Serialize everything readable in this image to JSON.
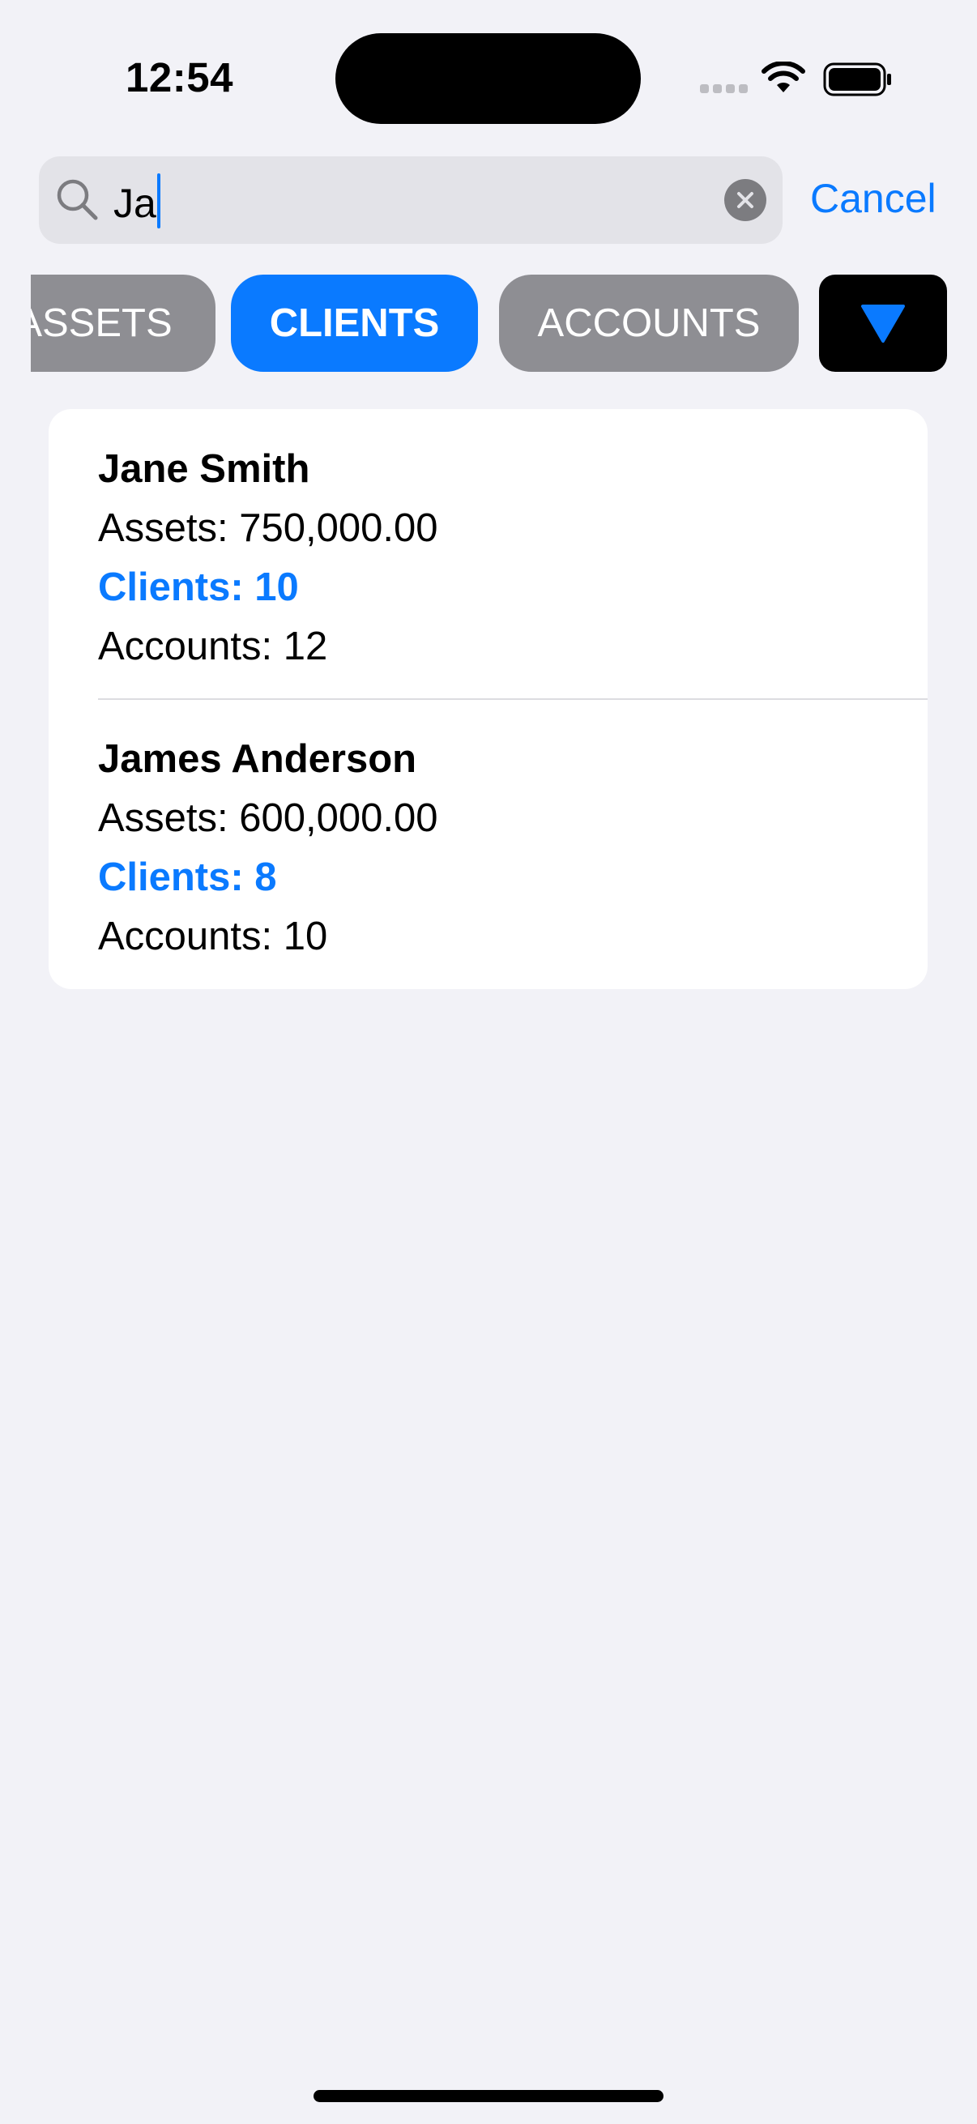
{
  "status_bar": {
    "time": "12:54"
  },
  "search": {
    "query": "Ja",
    "cancel_label": "Cancel",
    "icons": [
      "search-icon",
      "clear-icon"
    ]
  },
  "scopes": {
    "items": [
      {
        "label": "ASSETS",
        "selected": false
      },
      {
        "label": "CLIENTS",
        "selected": true
      },
      {
        "label": "ACCOUNTS",
        "selected": false
      }
    ],
    "filter_icon": "triangle-down-icon",
    "accent_color": "#0A7AFF"
  },
  "results": [
    {
      "name": "Jane Smith",
      "assets": "Assets: 750,000.00",
      "clients": "Clients: 10",
      "accounts": "Accounts: 12"
    },
    {
      "name": "James Anderson",
      "assets": "Assets: 600,000.00",
      "clients": "Clients: 8",
      "accounts": "Accounts: 10"
    }
  ]
}
